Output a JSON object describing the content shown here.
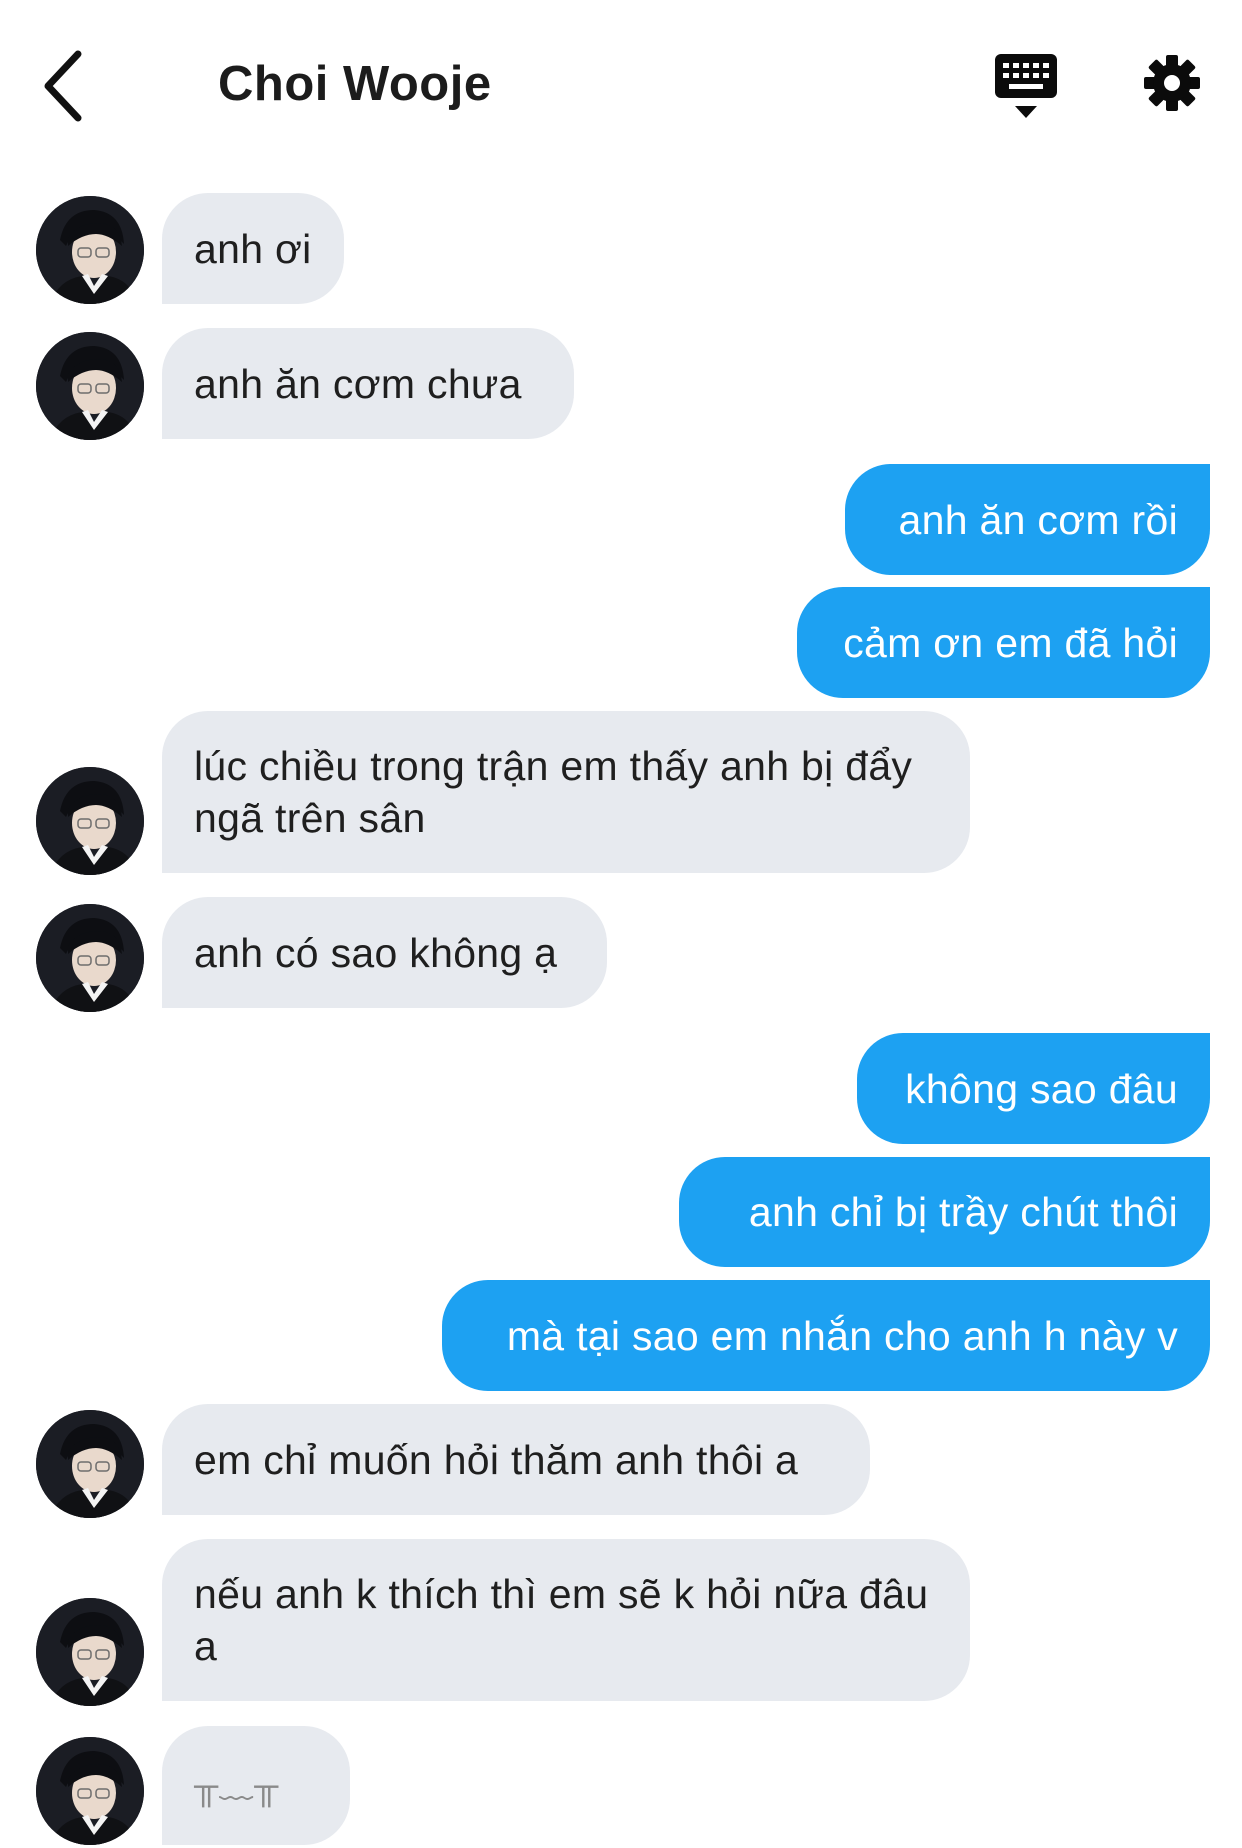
{
  "header": {
    "title": "Choi Wooje",
    "back_icon": "chevron-left-icon",
    "keyboard_icon": "keyboard-icon",
    "settings_icon": "gear-icon"
  },
  "colors": {
    "incoming_bubble": "#e7eaef",
    "outgoing_bubble": "#1da1f2",
    "incoming_text": "#1f1f1f",
    "outgoing_text": "#ffffff"
  },
  "messages": [
    {
      "side": "in",
      "text": "anh ơi"
    },
    {
      "side": "in",
      "text": "anh ăn cơm chưa"
    },
    {
      "side": "out",
      "text": "anh ăn cơm rồi"
    },
    {
      "side": "out",
      "text": "cảm ơn em đã hỏi"
    },
    {
      "side": "in",
      "text": "lúc chiều trong trận em thấy anh bị đẩy ngã trên sân"
    },
    {
      "side": "in",
      "text": "anh có sao không ạ"
    },
    {
      "side": "out",
      "text": "không sao đâu"
    },
    {
      "side": "out",
      "text": "anh chỉ bị trầy chút thôi"
    },
    {
      "side": "out",
      "text": "mà tại sao em nhắn cho anh h này v"
    },
    {
      "side": "in",
      "text": "em chỉ muốn hỏi thăm anh thôi a"
    },
    {
      "side": "in",
      "text": "nếu anh k thích thì em sẽ k hỏi nữa đâu a"
    },
    {
      "side": "in",
      "text": "╥﹏╥"
    }
  ]
}
